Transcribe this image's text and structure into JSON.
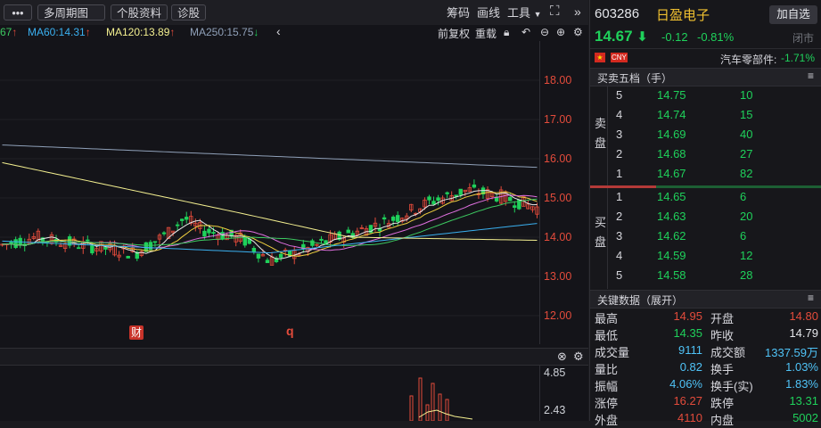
{
  "toolbar": {
    "more_label": "•••",
    "period_label": "多周期图",
    "profile_label": "个股资料",
    "diagnose_label": "诊股",
    "chips_label": "筹码",
    "draw_label": "画线",
    "tools_label": "工具",
    "fq_label": "前复权",
    "reset_label": "重载"
  },
  "ma": {
    "ma30": "67",
    "ma60": "MA60:14.31",
    "ma120": "MA120:13.89",
    "ma250": "MA250:15.75"
  },
  "colors": {
    "up": "#e34b3b",
    "down": "#1fd15b",
    "ma5": "#e8e8e8",
    "ma10": "#f0d040",
    "ma20": "#e070e0",
    "ma30": "#3cc860",
    "ma60": "#3ab0f0",
    "ma120": "#f4f090",
    "ma250": "#8fa0b8"
  },
  "yaxis_labels": [
    "18.00",
    "17.00",
    "16.00",
    "15.00",
    "14.00",
    "13.00",
    "12.00"
  ],
  "markers": {
    "finance": "财",
    "q": "q"
  },
  "sub_axis": [
    "4.85",
    "2.43"
  ],
  "stock": {
    "code": "603286",
    "name": "日盈电子",
    "add_label": "加自选",
    "price": "14.67",
    "change": "-0.12",
    "change_pct": "-0.81%",
    "status": "闭市",
    "currency": "CNY",
    "industry": "汽车零部件:",
    "industry_pct": "-1.71%"
  },
  "orderbook": {
    "title": "买卖五档（手）",
    "sell_label": "卖盘",
    "buy_label": "买盘",
    "sells": [
      {
        "idx": "5",
        "price": "14.75",
        "vol": "10"
      },
      {
        "idx": "4",
        "price": "14.74",
        "vol": "15"
      },
      {
        "idx": "3",
        "price": "14.69",
        "vol": "40"
      },
      {
        "idx": "2",
        "price": "14.68",
        "vol": "27"
      },
      {
        "idx": "1",
        "price": "14.67",
        "vol": "82"
      }
    ],
    "buys": [
      {
        "idx": "1",
        "price": "14.65",
        "vol": "6"
      },
      {
        "idx": "2",
        "price": "14.63",
        "vol": "20"
      },
      {
        "idx": "3",
        "price": "14.62",
        "vol": "6"
      },
      {
        "idx": "4",
        "price": "14.59",
        "vol": "12"
      },
      {
        "idx": "5",
        "price": "14.58",
        "vol": "28"
      }
    ]
  },
  "key_data": {
    "title": "关键数据（展开）",
    "rows": [
      [
        {
          "label": "最高",
          "value": "14.95",
          "color": "#e34b3b"
        },
        {
          "label": "开盘",
          "value": "14.80",
          "color": "#e34b3b"
        }
      ],
      [
        {
          "label": "最低",
          "value": "14.35",
          "color": "#1fd15b"
        },
        {
          "label": "昨收",
          "value": "14.79",
          "color": "#e4e6ea"
        }
      ],
      [
        {
          "label": "成交量",
          "value": "9111",
          "color": "#4fc3f7"
        },
        {
          "label": "成交额",
          "value": "1337.59万",
          "color": "#4fc3f7"
        }
      ],
      [
        {
          "label": "量比",
          "value": "0.82",
          "color": "#4fc3f7"
        },
        {
          "label": "换手",
          "value": "1.03%",
          "color": "#4fc3f7"
        }
      ],
      [
        {
          "label": "振幅",
          "value": "4.06%",
          "color": "#4fc3f7"
        },
        {
          "label": "换手(实)",
          "value": "1.83%",
          "color": "#4fc3f7"
        }
      ],
      [
        {
          "label": "涨停",
          "value": "16.27",
          "color": "#e34b3b"
        },
        {
          "label": "跌停",
          "value": "13.31",
          "color": "#1fd15b"
        }
      ],
      [
        {
          "label": "外盘",
          "value": "4110",
          "color": "#e34b3b"
        },
        {
          "label": "内盘",
          "value": "5002",
          "color": "#1fd15b"
        }
      ]
    ]
  }
}
